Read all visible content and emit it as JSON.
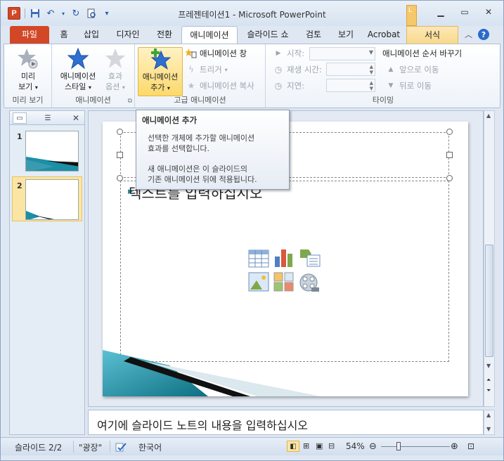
{
  "titlebar": {
    "app_letter": "P",
    "title": "프레젠테이션1 - Microsoft PowerPoint",
    "context_tab_letter": "L"
  },
  "tabs": [
    "파일",
    "홈",
    "삽입",
    "디자인",
    "전환",
    "애니메이션",
    "슬라이드 쇼",
    "검토",
    "보기",
    "Acrobat",
    "서식"
  ],
  "ribbon": {
    "preview": {
      "label1": "미리",
      "label2": "보기",
      "arrow": "▾",
      "group": "미리 보기"
    },
    "animation": {
      "style1": "애니메이션",
      "style2": "스타일",
      "effect1": "효과",
      "effect2": "옵션",
      "group": "애니메이션"
    },
    "advanced": {
      "add1": "애니메이션",
      "add2": "추가",
      "pane": "애니메이션 창",
      "trigger": "트리거",
      "painter": "애니메이션 복사",
      "group": "고급 애니메이션"
    },
    "timing": {
      "start": "시작:",
      "duration": "재생 시간:",
      "delay": "지연:",
      "reorder": "애니메이션 순서 바꾸기",
      "earlier": "앞으로 이동",
      "later": "뒤로 이동",
      "group": "타이밍"
    }
  },
  "slides": [
    {
      "num": "1"
    },
    {
      "num": "2"
    }
  ],
  "slide": {
    "bullet_text": "텍스트를 입력하십시오"
  },
  "tooltip": {
    "title": "애니메이션 추가",
    "body1": "선택한 개체에 추가할 애니메이션",
    "body2": "효과를 선택합니다.",
    "body3": "새 애니메이션은 이 슬라이드의",
    "body4": "기존 애니메이션 뒤에 적용됩니다."
  },
  "notes": {
    "placeholder": "여기에 슬라이드 노트의 내용을 입력하십시오"
  },
  "status": {
    "slide": "슬라이드 2/2",
    "theme": "\"광장\"",
    "language": "한국어",
    "zoom": "54%"
  },
  "colors": {
    "file_tab": "#d24726",
    "accent": "#1b8fa6"
  }
}
